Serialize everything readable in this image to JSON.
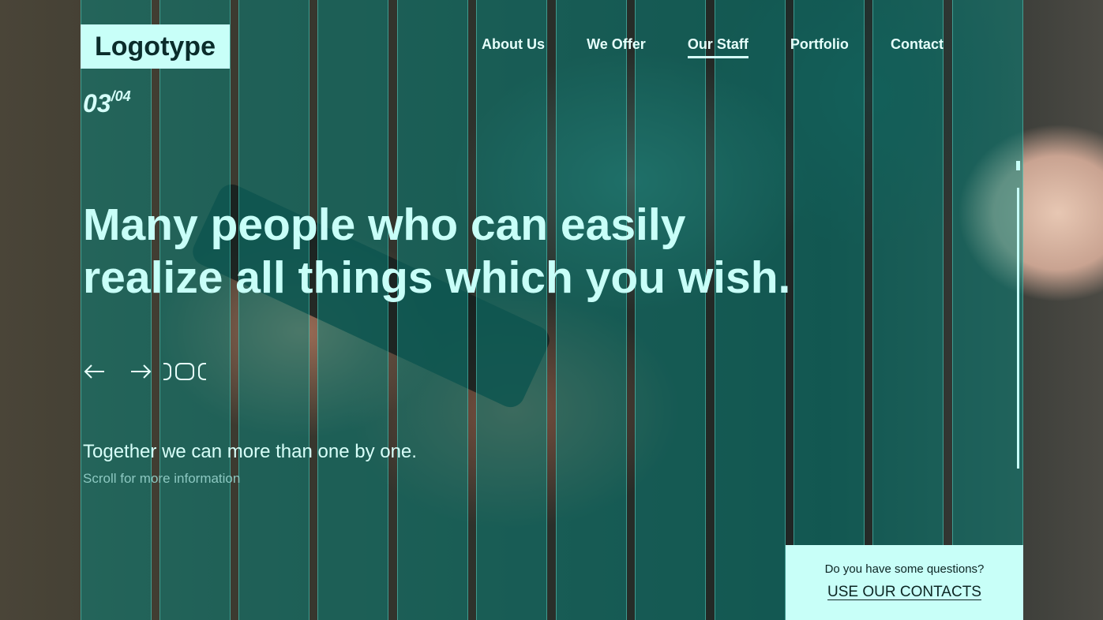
{
  "brand": {
    "logo_text": "Logotype"
  },
  "nav": {
    "items": [
      {
        "label": "About Us",
        "active": false
      },
      {
        "label": "We Offer",
        "active": false
      },
      {
        "label": "Our Staff",
        "active": true
      },
      {
        "label": "Portfolio",
        "active": false
      },
      {
        "label": "Contact",
        "active": false
      }
    ]
  },
  "slider": {
    "current": "03",
    "total": "/04",
    "prev_icon": "arrow-left-icon",
    "next_icon": "arrow-right-icon",
    "pagination_icon": "slide-dots-icon"
  },
  "hero": {
    "headline_line1": "Many people who can easily",
    "headline_line2": "realize all things which you wish.",
    "tagline": "Together we can more than one by one.",
    "scroll_hint": "Scroll for more information"
  },
  "contact": {
    "question": "Do you have some questions?",
    "link_label": "USE OUR CONTACTS"
  },
  "colors": {
    "accent": "#c8fff8",
    "overlay": "#0a8278",
    "text_dark": "#0c2523"
  }
}
